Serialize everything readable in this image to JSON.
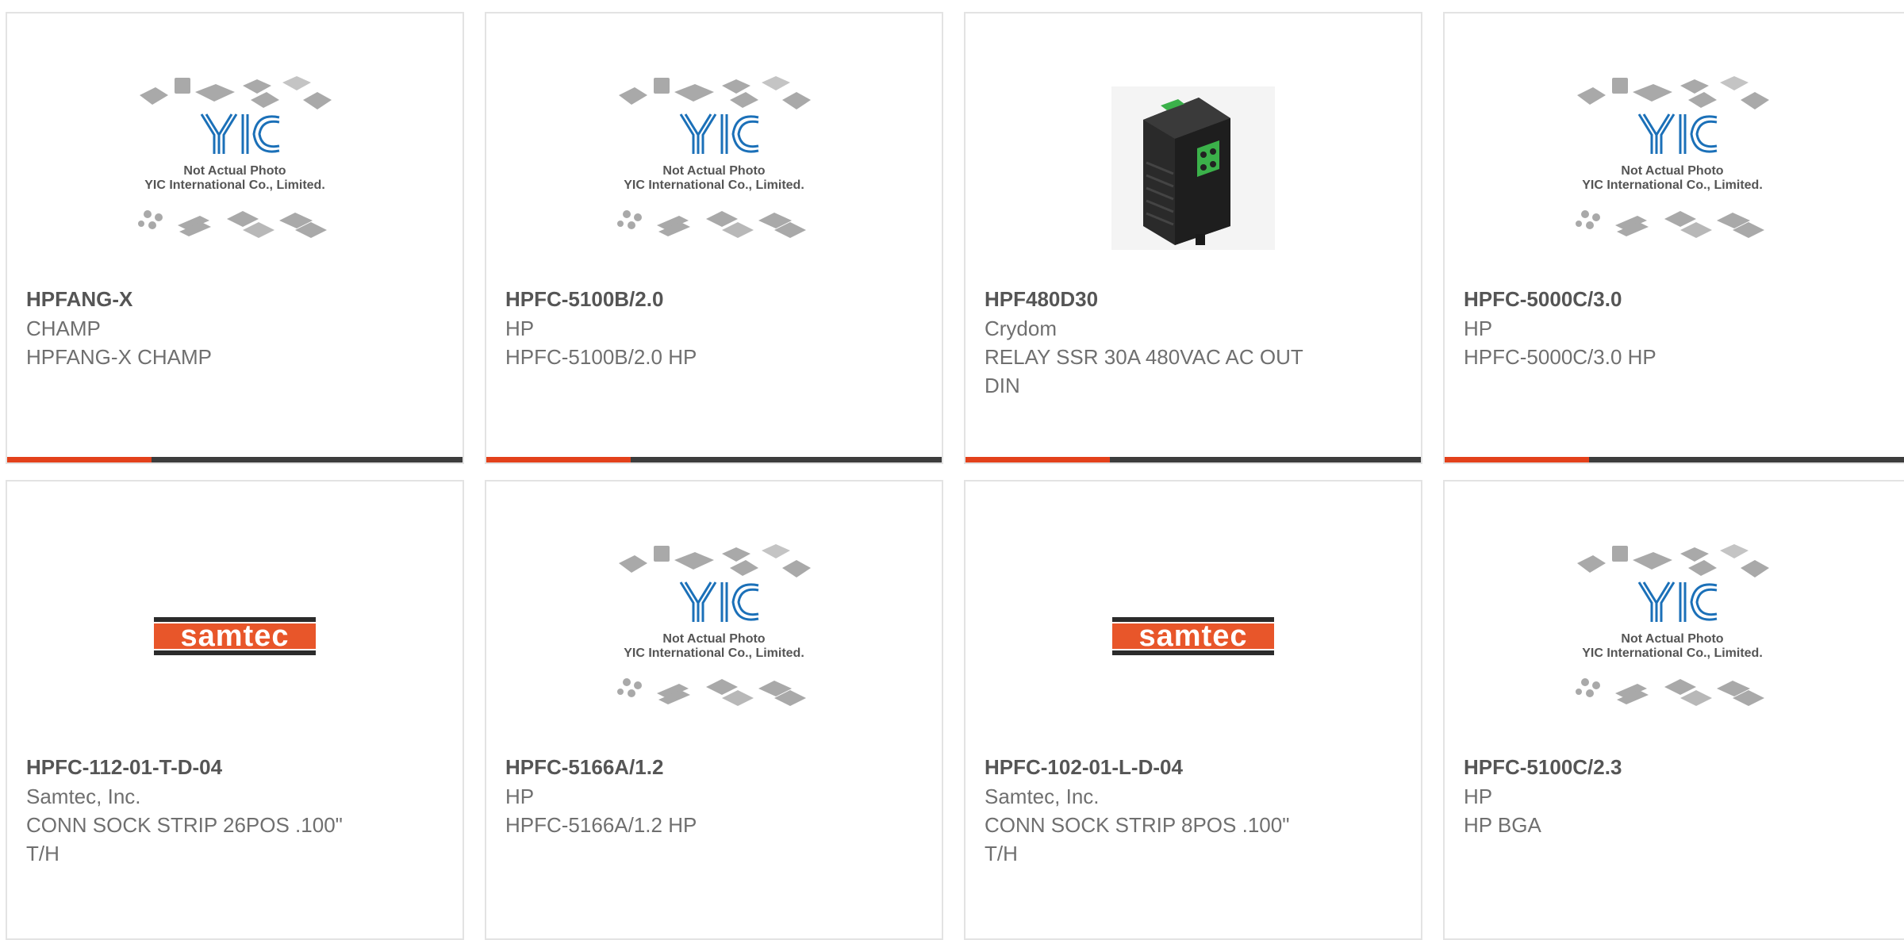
{
  "colors": {
    "accent": "#e3411b",
    "bar_dark": "#3d3d3d",
    "samtec_orange": "#e8562a",
    "yic_blue": "#1b70b8"
  },
  "products": [
    {
      "part_number": "HPFANG-X",
      "manufacturer": "CHAMP",
      "description": "HPFANG-X CHAMP",
      "image": "yic-placeholder",
      "placeholder_line1": "Not Actual Photo",
      "placeholder_line2": "YIC International Co., Limited."
    },
    {
      "part_number": "HPFC-5100B/2.0",
      "manufacturer": "HP",
      "description": "HPFC-5100B/2.0 HP",
      "image": "yic-placeholder",
      "placeholder_line1": "Not Actual Photo",
      "placeholder_line2": "YIC International Co., Limited."
    },
    {
      "part_number": "HPF480D30",
      "manufacturer": "Crydom",
      "description": "RELAY SSR 30A 480VAC AC OUT DIN",
      "image": "relay-photo"
    },
    {
      "part_number": "HPFC-5000C/3.0",
      "manufacturer": "HP",
      "description": "HPFC-5000C/3.0 HP",
      "image": "yic-placeholder",
      "placeholder_line1": "Not Actual Photo",
      "placeholder_line2": "YIC International Co., Limited."
    },
    {
      "part_number": "HPFC-112-01-T-D-04",
      "manufacturer": "Samtec, Inc.",
      "description": "CONN SOCK STRIP 26POS .100\" T/H",
      "image": "samtec-logo",
      "logo_text": "samtec"
    },
    {
      "part_number": "HPFC-5166A/1.2",
      "manufacturer": "HP",
      "description": "HPFC-5166A/1.2 HP",
      "image": "yic-placeholder",
      "placeholder_line1": "Not Actual Photo",
      "placeholder_line2": "YIC International Co., Limited."
    },
    {
      "part_number": "HPFC-102-01-L-D-04",
      "manufacturer": "Samtec, Inc.",
      "description": "CONN SOCK STRIP 8POS .100\" T/H",
      "image": "samtec-logo",
      "logo_text": "samtec"
    },
    {
      "part_number": "HPFC-5100C/2.3",
      "manufacturer": "HP",
      "description": "HP BGA",
      "image": "yic-placeholder",
      "placeholder_line1": "Not Actual Photo",
      "placeholder_line2": "YIC International Co., Limited."
    }
  ]
}
